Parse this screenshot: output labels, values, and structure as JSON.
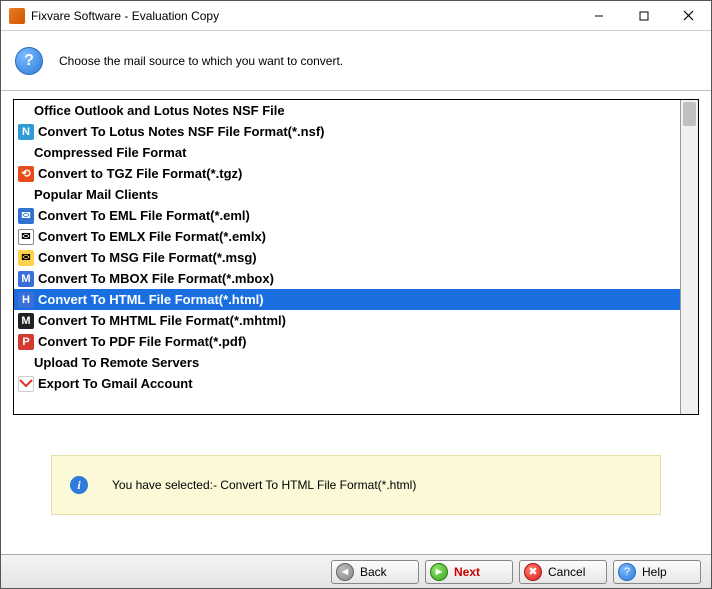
{
  "window": {
    "title": "Fixvare Software - Evaluation Copy"
  },
  "header": {
    "instruction": "Choose the mail source to which you want to convert."
  },
  "list": {
    "sections": [
      {
        "label": "Office Outlook and Lotus Notes NSF File"
      },
      {
        "label": "Compressed File Format"
      },
      {
        "label": "Popular Mail Clients"
      },
      {
        "label": "Upload To Remote Servers"
      }
    ],
    "items": {
      "nsf": "Convert To Lotus Notes NSF File Format(*.nsf)",
      "tgz": "Convert to TGZ File Format(*.tgz)",
      "eml": "Convert To EML File Format(*.eml)",
      "emlx": "Convert To EMLX File Format(*.emlx)",
      "msg": "Convert To MSG File Format(*.msg)",
      "mbox": "Convert To MBOX File Format(*.mbox)",
      "html": "Convert To HTML File Format(*.html)",
      "mhtml": "Convert To MHTML File Format(*.mhtml)",
      "pdf": "Convert To PDF File Format(*.pdf)",
      "gmail": "Export To Gmail Account"
    }
  },
  "info": {
    "message": "You have selected:- Convert To HTML File Format(*.html)"
  },
  "buttons": {
    "back": "Back",
    "next": "Next",
    "cancel": "Cancel",
    "help": "Help"
  }
}
